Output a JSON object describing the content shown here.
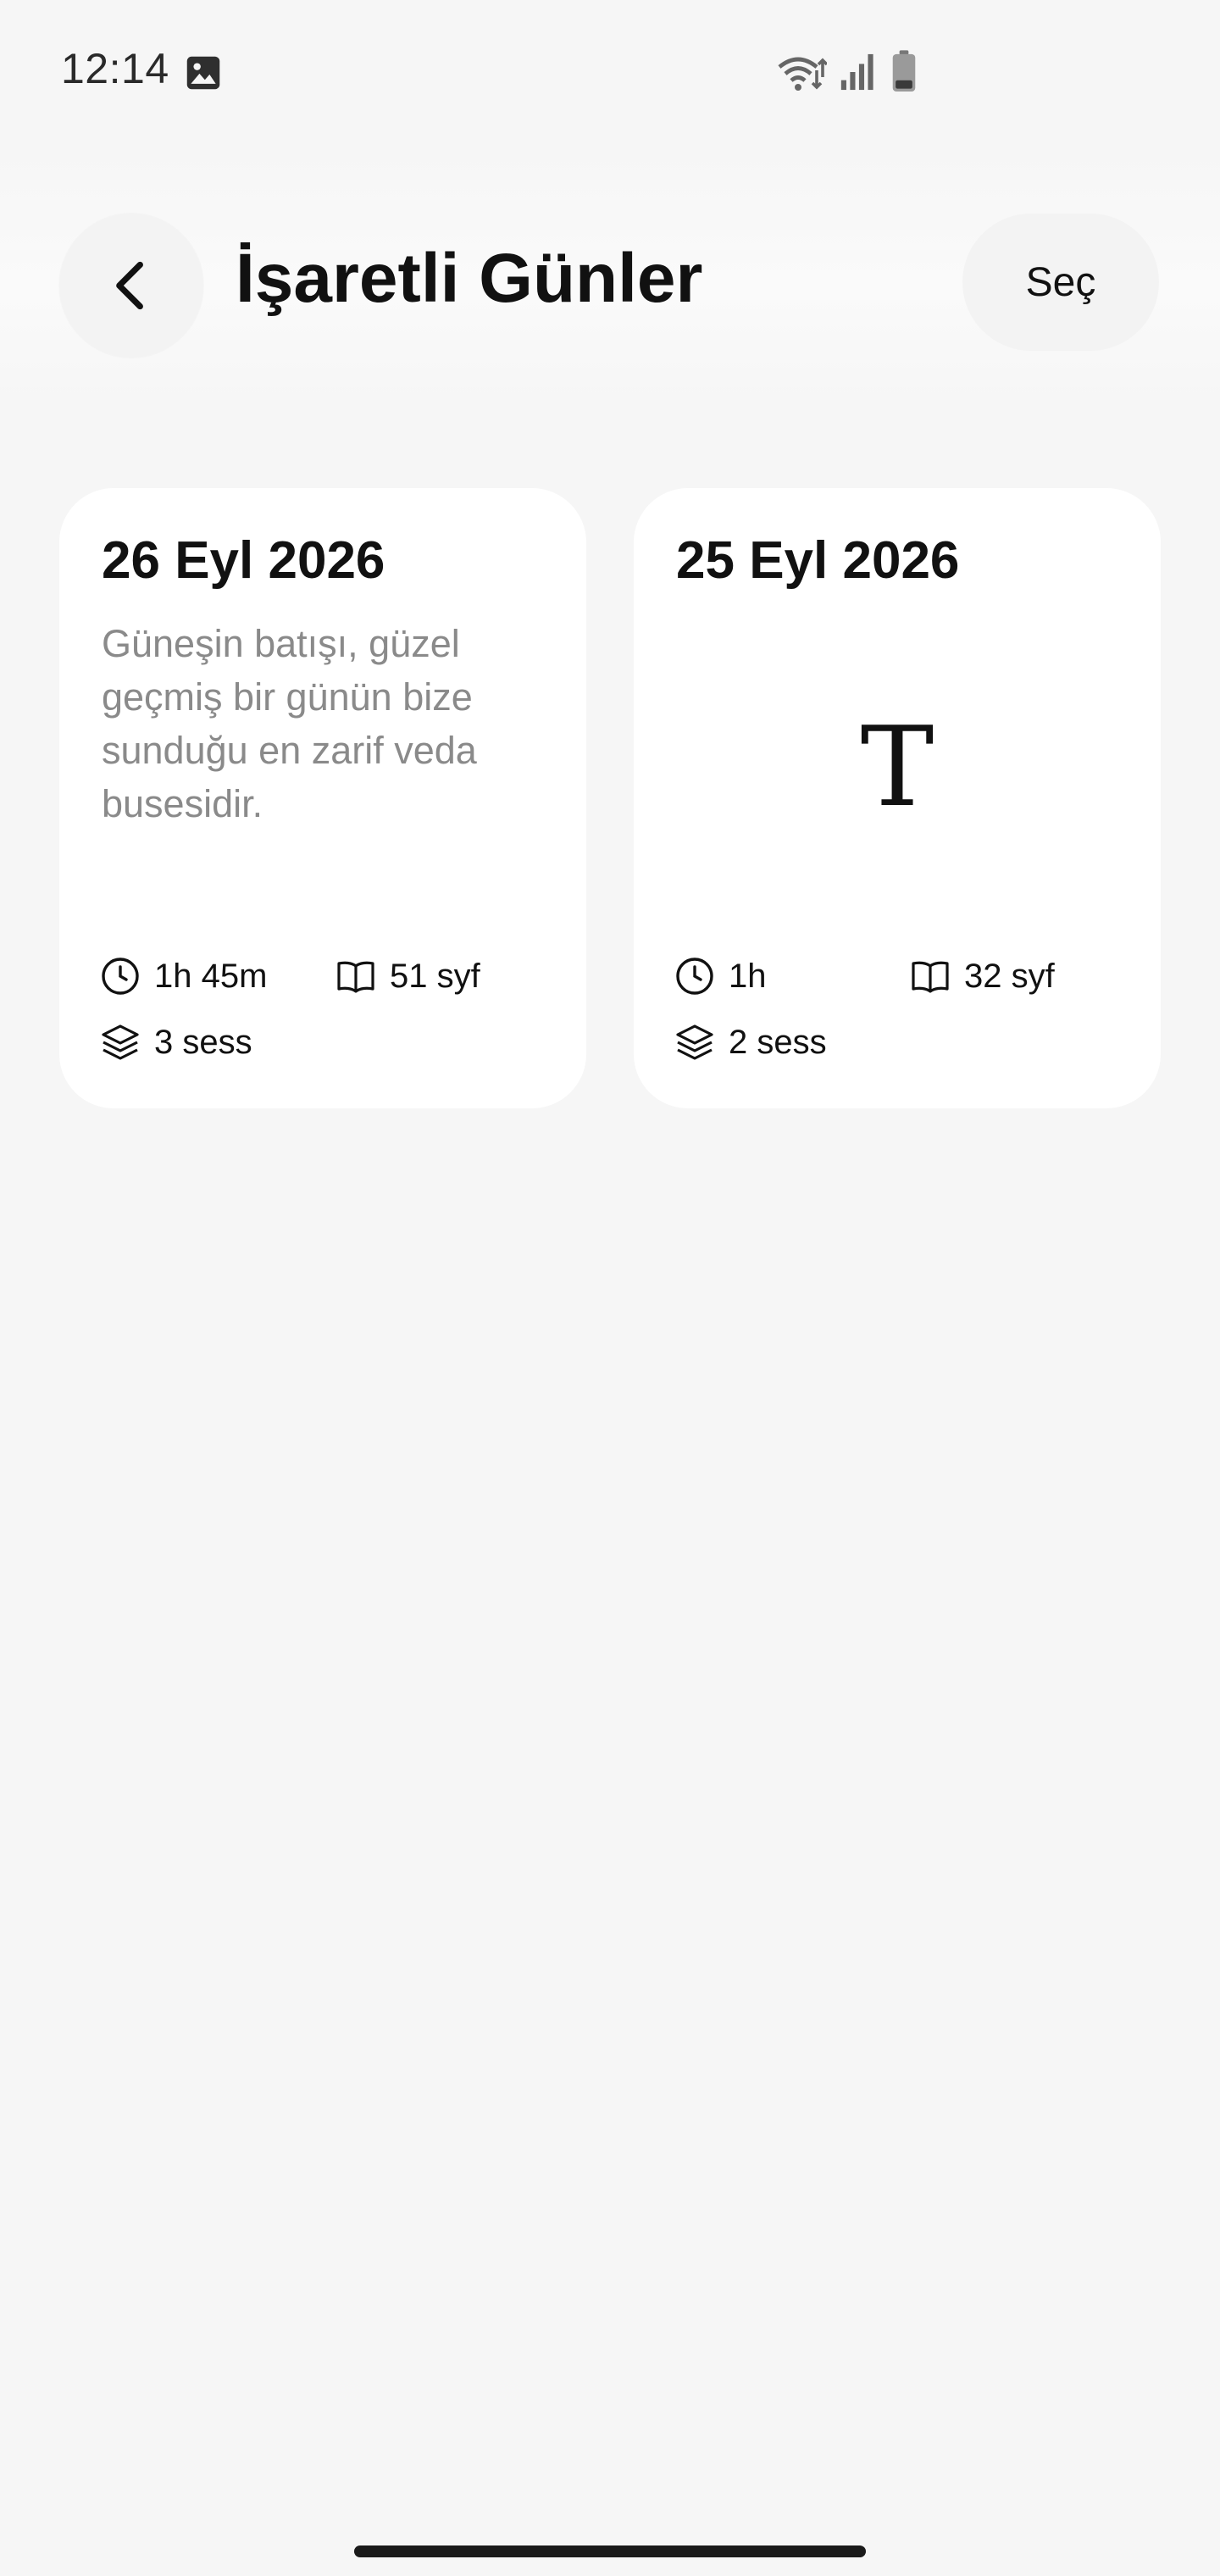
{
  "status_bar": {
    "time": "12:14",
    "icons": [
      "gallery-icon",
      "wifi-icon",
      "signal-icon",
      "battery-icon"
    ]
  },
  "header": {
    "title": "İşaretli Günler",
    "select_label": "Seç",
    "back_icon": "chevron-left-icon"
  },
  "cards": [
    {
      "date": "26 Eyl 2026",
      "note": "Güneşin batışı, güzel geçmiş bir günün bize sunduğu en zarif veda busesidir.",
      "placeholder": "",
      "time": "1h 45m",
      "pages": "51 syf",
      "sessions": "3 sess"
    },
    {
      "date": "25 Eyl 2026",
      "note": "",
      "placeholder": "T",
      "time": "1h",
      "pages": "32 syf",
      "sessions": "2 sess"
    }
  ],
  "colors": {
    "background": "#f6f6f6",
    "card": "#ffffff",
    "button": "#f3f3f3",
    "text": "#111111",
    "muted_text": "#8a8a8a"
  }
}
